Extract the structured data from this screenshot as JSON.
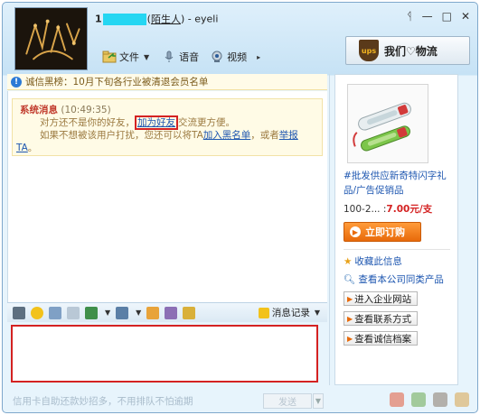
{
  "window": {
    "title_number": "1",
    "title_tag": "陌生人",
    "title_sep": ")",
    "title_name": " - eyeli",
    "controls": [
      "ᛩ",
      "—",
      "□",
      "✕"
    ]
  },
  "toolbar": {
    "file": "文件",
    "voice": "语音",
    "video": "视频"
  },
  "ad_button": {
    "logo": "ups",
    "label": "我们♡物流"
  },
  "notice": {
    "icon": "!",
    "text": "诚信黑榜：10月下旬各行业被清退会员名单"
  },
  "system_message": {
    "title": "系统消息",
    "time": "(10:49:35)",
    "line1_pre": "对方还不是你的好友，",
    "line1_link": "加为好友",
    "line1_post": "交流更方便。",
    "line2_pre": "如果不想被该用户打扰，您还可以将TA",
    "line2_link1": "加入黑名单",
    "line2_mid": "，或者",
    "line2_link2": "举报",
    "line3_link": "TA",
    "line3_post": "。"
  },
  "format_bar": {
    "history_label": "消息记录"
  },
  "bottom": {
    "ad_text": "信用卡自助还款妙招多，不用排队不怕逾期",
    "send_label": "发送"
  },
  "product": {
    "title": "#批发供应新奇特闪字礼品/广告促销品",
    "price_prefix": "100-2... :",
    "price": "7.00元/支",
    "order_button": "立即订购",
    "favorite": "收藏此信息",
    "view_more": "查看本公司同类产品",
    "buttons": [
      "进入企业网站",
      "查看联系方式",
      "查看诚信档案"
    ]
  },
  "colors": {
    "accent_red": "#d42222",
    "link_blue": "#1d56b0",
    "order_orange": "#e86a0a"
  }
}
